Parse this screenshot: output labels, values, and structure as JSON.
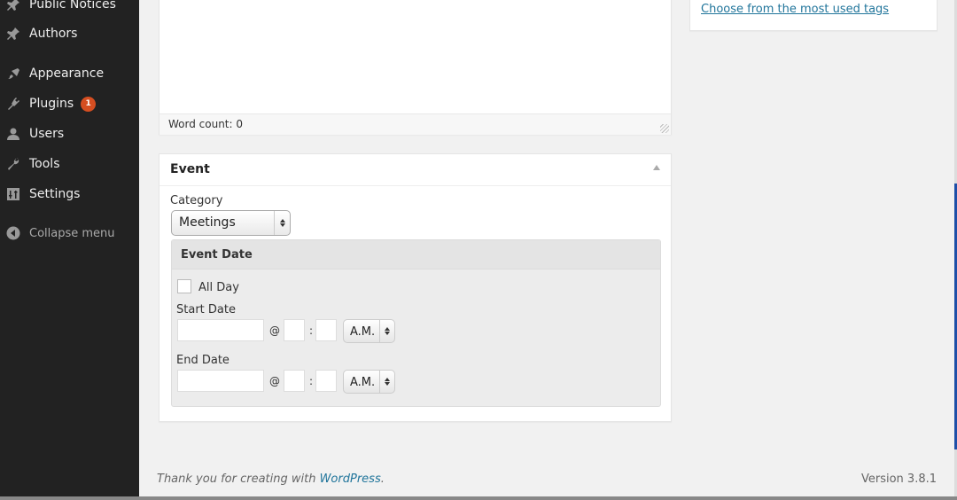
{
  "sidebar": {
    "items": [
      {
        "label": "Public Notices",
        "icon": "pin-icon"
      },
      {
        "label": "Authors",
        "icon": "pin-icon"
      },
      {
        "label": "Appearance",
        "icon": "paintbrush-icon"
      },
      {
        "label": "Plugins",
        "icon": "plug-icon",
        "badge": "1"
      },
      {
        "label": "Users",
        "icon": "user-icon"
      },
      {
        "label": "Tools",
        "icon": "wrench-icon"
      },
      {
        "label": "Settings",
        "icon": "sliders-icon"
      }
    ],
    "collapse_label": "Collapse menu"
  },
  "editor": {
    "word_count": "Word count: 0"
  },
  "tags": {
    "most_used_link": "Choose from the most used tags"
  },
  "event": {
    "title": "Event",
    "category_label": "Category",
    "category_value": "Meetings",
    "event_date_title": "Event Date",
    "all_day_label": "All Day",
    "all_day_checked": false,
    "start_date_label": "Start Date",
    "end_date_label": "End Date",
    "start_date_value": "",
    "start_hour": "",
    "start_minute": "",
    "start_meridian": "A.M.",
    "end_date_value": "",
    "end_hour": "",
    "end_minute": "",
    "end_meridian": "A.M.",
    "at_symbol": "@",
    "colon": ":"
  },
  "footer": {
    "thanks_prefix": "Thank you for creating with ",
    "wordpress_link": "WordPress",
    "thanks_suffix": ".",
    "version": "Version 3.8.1"
  },
  "colors": {
    "sidebar_bg": "#222222",
    "badge": "#d54e21",
    "link": "#21759b",
    "page_bg": "#f1f1f1"
  }
}
